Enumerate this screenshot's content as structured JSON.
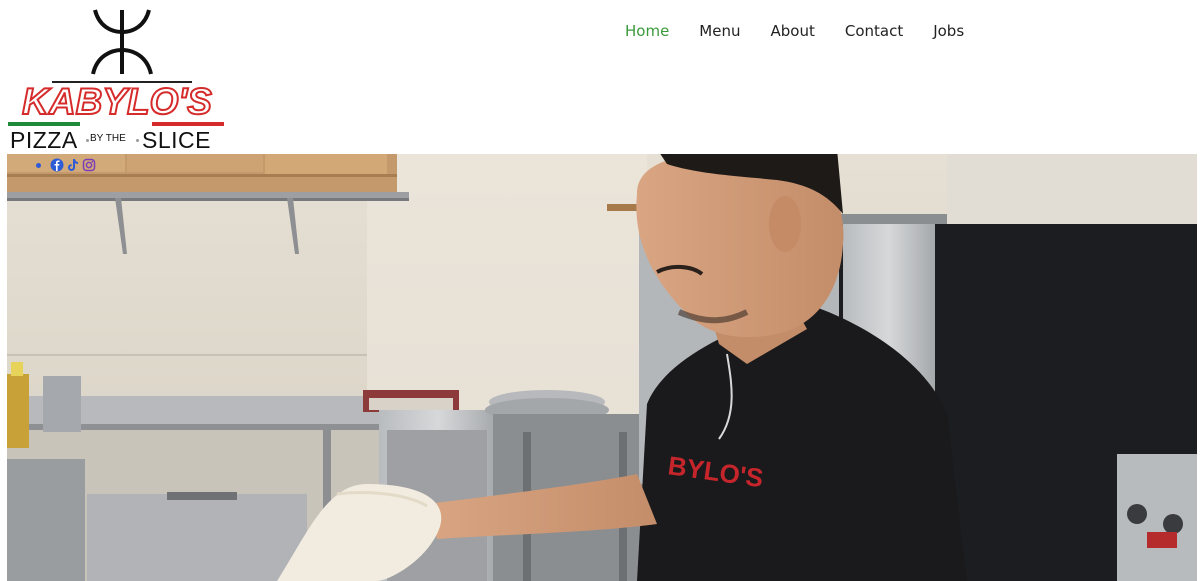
{
  "brand": {
    "name": "KABYLO'S",
    "pizza": "PIZZA",
    "by_the": "BY THE",
    "slice": "SLICE",
    "logo_icon": "yaz-symbol-icon"
  },
  "nav": {
    "items": [
      {
        "label": "Home",
        "active": true
      },
      {
        "label": "Menu",
        "active": false
      },
      {
        "label": "About",
        "active": false
      },
      {
        "label": "Contact",
        "active": false
      },
      {
        "label": "Jobs",
        "active": false
      }
    ]
  },
  "social": {
    "icons": [
      "facebook-icon",
      "tiktok-icon",
      "instagram-icon"
    ],
    "color": "#2e5bd6"
  },
  "hero": {
    "image": "chef-tossing-pizza-dough-photo",
    "shirt_text": "KABYLO'S"
  },
  "colors": {
    "nav_active": "#3a9a3a",
    "brand_red": "#d62b2b",
    "brand_green": "#1e8a3a"
  }
}
